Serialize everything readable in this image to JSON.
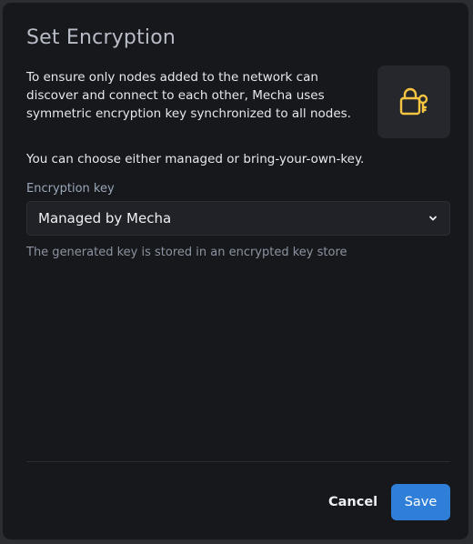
{
  "dialog": {
    "title": "Set Encryption",
    "description": "To ensure only nodes added to the network can discover and connect to each other, Mecha uses symmetric encryption key synchronized to all nodes.",
    "choose_text": "You can choose either managed or bring-your-own-key.",
    "icon": "lock-key-icon",
    "accent_color": "#f5c542"
  },
  "encryption_key": {
    "label": "Encryption key",
    "selected": "Managed by Mecha",
    "helper": "The generated key is stored in an encrypted key store"
  },
  "actions": {
    "cancel_label": "Cancel",
    "save_label": "Save",
    "save_color": "#2f7fd8"
  }
}
